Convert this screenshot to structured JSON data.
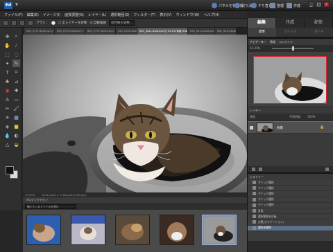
{
  "title_bar": {
    "logo": "Ed",
    "dropdown": "▼",
    "actions": [
      {
        "label": "パネルを初期化"
      },
      {
        "label": "取り消し"
      },
      {
        "label": "やり直し"
      },
      {
        "label": "整理"
      },
      {
        "label": "作成"
      }
    ],
    "window": {
      "minimize": "_",
      "maximize": "□",
      "close": "×"
    }
  },
  "menu": [
    "ファイル(F)",
    "編集(E)",
    "イメージ(I)",
    "画質調整(N)",
    "レイヤー(L)",
    "選択範囲(S)",
    "フィルター(T)",
    "表示(V)",
    "ウィンドウ(W)",
    "ヘルプ(H)"
  ],
  "options_bar": {
    "brush_label": "ブラシ：",
    "brush_size": "●",
    "sample_all": "☐ 全レイヤーを対象",
    "auto_enhance": "☑ 自動強調",
    "refine_button": "境界線を調整..."
  },
  "doc_tabs": [
    {
      "label": "IMG_0737-4b4f.psd ×"
    },
    {
      "label": "IMG_0755-4b4f.psd ×"
    },
    {
      "label": "IMG_0757-4b4f.psd ×"
    },
    {
      "label": "IMG_0765-4b4f.psd ×"
    },
    {
      "label": "IMG_0811-4b4f.psd @ 33.3%(背景,RGB/8) ×",
      "active": true
    },
    {
      "label": "IMG_0813-4b4f.psd ×"
    },
    {
      "label": "IMG_0814-4b4f.psd ×"
    }
  ],
  "status": {
    "zoom": "33.33%",
    "doc_info": "2592 pixel × 1728 pixel (240 ppi)"
  },
  "project_bin": {
    "title": "プロジェクトビン",
    "select_value": "開いているファイルを表示",
    "thumbs": [
      "thumb-1",
      "thumb-2",
      "thumb-3",
      "thumb-4",
      "thumb-5"
    ]
  },
  "right_panel": {
    "tabs": [
      {
        "label": "編集",
        "active": true
      },
      {
        "label": "作成"
      },
      {
        "label": "配信"
      }
    ],
    "subtabs": [
      {
        "label": "標準",
        "active": true
      },
      {
        "label": "クイック"
      },
      {
        "label": "ガイド"
      }
    ],
    "navigator": {
      "tabs": [
        "ナビゲーター",
        "情報",
        "コンテンツ"
      ],
      "zoom": "33.33%"
    },
    "layers": {
      "title": "レイヤー",
      "mode": "通常",
      "opacity_label": "不透明度:",
      "opacity": "100%",
      "row": {
        "name": "背景",
        "lock": "🔒"
      }
    },
    "history": {
      "title": "ヒストリー",
      "items": [
        {
          "label": "クイック選択"
        },
        {
          "label": "クイック選択"
        },
        {
          "label": "クイック選択"
        },
        {
          "label": "クイック選択"
        },
        {
          "label": "クイック選択"
        },
        {
          "label": "反転"
        },
        {
          "label": "選択範囲を反転"
        },
        {
          "label": "白黒(グラデーション)"
        },
        {
          "label": "選択を解除",
          "active": true
        }
      ]
    }
  },
  "colors": {
    "accent": "#1f5ea8",
    "selected": "#5e6f88",
    "nav_frame": "#dd2233"
  }
}
